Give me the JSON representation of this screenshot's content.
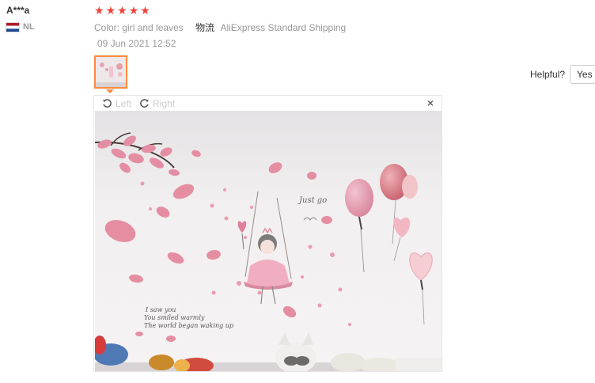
{
  "review": {
    "user_name": "A***a",
    "country_code": "NL",
    "rating": 5,
    "stars": [
      "★",
      "★",
      "★",
      "★",
      "★"
    ],
    "sku_color_key": "Color:",
    "sku_color_value": "girl and leaves",
    "shipping_key": "物流",
    "shipping_value": "AliExpress Standard Shipping",
    "date": "09 Jun 2021 12:52"
  },
  "helpful": {
    "label": "Helpful?",
    "yes_label": "Yes"
  },
  "viewer": {
    "rotate_left_label": "Left",
    "rotate_right_label": "Right",
    "close_label": "×",
    "photo_caption_lines": [
      "I saw you",
      "You smiled warmly",
      "The world began waking up"
    ],
    "photo_script_text": "Just go"
  },
  "colors": {
    "star": "#f0433a",
    "accent": "#ff8a3d",
    "muted": "#999999"
  },
  "icons": [
    "netherlands-flag-icon",
    "star-icon",
    "rotate-left-icon",
    "rotate-right-icon",
    "close-icon"
  ]
}
